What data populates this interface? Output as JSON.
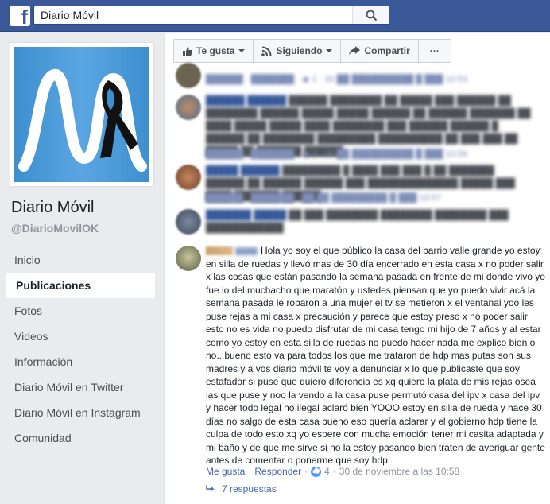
{
  "header": {
    "logo": "f",
    "search_value": "Diario Móvil"
  },
  "page": {
    "name": "Diario Móvil",
    "handle": "@DiarioMovilOK"
  },
  "nav": [
    {
      "label": "Inicio",
      "active": false
    },
    {
      "label": "Publicaciones",
      "active": true
    },
    {
      "label": "Fotos",
      "active": false
    },
    {
      "label": "Videos",
      "active": false
    },
    {
      "label": "Información",
      "active": false
    },
    {
      "label": "Diario Móvil en Twitter",
      "active": false
    },
    {
      "label": "Diario Móvil en Instagram",
      "active": false
    },
    {
      "label": "Comunidad",
      "active": false
    }
  ],
  "actions": {
    "like": "Te gusta",
    "following": "Siguiendo",
    "share": "Compartir",
    "more": "···"
  },
  "main_comment": {
    "text": "Hola yo soy el que público la casa del barrio valle grande yo estoy en silla de ruedas y llevó mas de 30 día encerrado en esta casa x no poder salir x las cosas que están pasando la semana pasada en frente de mi donde vivo yo fue lo del muchacho que maratón y ustedes piensan que yo puedo vivir acá la semana pasada le robaron a una mujer el tv se metieron x el ventanal yoo les puse rejas a mi casa x precaución y parece que estoy preso x no poder salir esto no es vida no puedo disfrutar de mi casa tengo mi hijo de 7 años y al estar como yo estoy en esta silla de ruedas no puedo hacer nada me explico bien o no...bueno esto va para todos los que me trataron de hdp mas putas son sus madres y a vos diario móvil te voy a denunciar x lo que publicaste que soy estafador si puse que quiero diferencia es xq quiero la plata de mis rejas osea las que puse y noo la vendo a la casa puse permutó casa del ipv x casa del ipv y hacer todo legal no ilegal aclaró bien YOOO estoy en silla de rueda y hace 30 días no salgo de esta casa bueno eso quería aclarar y el gobierno hdp tiene la culpa de todo esto xq yo espere con mucha emoción tener mi casita adaptada y mi baño y de que me sirve si no la estoy pasando bien traten de averiguar gente antes de comentar o ponerme que soy hdp",
    "like_label": "Me gusta",
    "reply_label": "Responder",
    "reaction_count": "4",
    "timestamp": "30 de noviembre a las 10:58",
    "replies_label": "7 respuestas",
    "more": "···"
  },
  "colors": {
    "topbar": "#3b5998",
    "link": "#4267b2",
    "muted": "#90949c"
  }
}
